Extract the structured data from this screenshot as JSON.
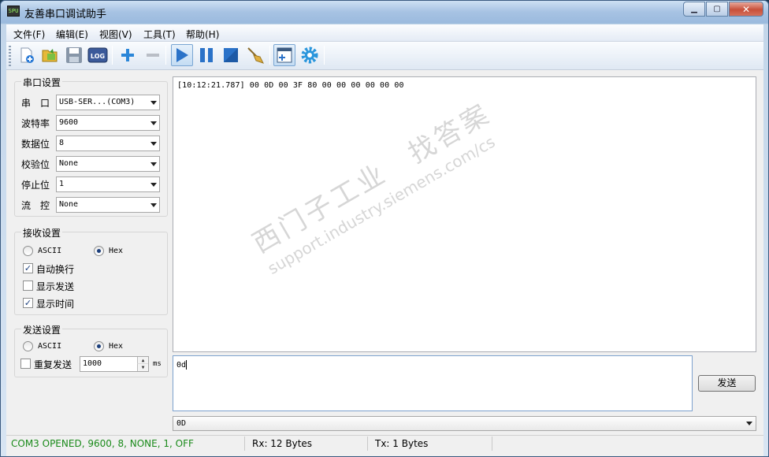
{
  "window": {
    "title": "友善串口调试助手",
    "icon_text": "SPU"
  },
  "menu": [
    {
      "label": "文件(F)"
    },
    {
      "label": "编辑(E)"
    },
    {
      "label": "视图(V)"
    },
    {
      "label": "工具(T)"
    },
    {
      "label": "帮助(H)"
    }
  ],
  "toolbar": {
    "log_label": "LOG",
    "icons": [
      "new-file-icon",
      "open-folder-icon",
      "save-icon",
      "log-icon",
      "add-icon",
      "remove-icon",
      "play-icon",
      "pause-icon",
      "stop-icon",
      "clear-broom-icon",
      "add-window-icon",
      "settings-gear-icon"
    ]
  },
  "serial_settings": {
    "title": "串口设置",
    "rows": [
      {
        "label": "串　口",
        "value": "USB-SER...(COM3)"
      },
      {
        "label": "波特率",
        "value": "9600"
      },
      {
        "label": "数据位",
        "value": "8"
      },
      {
        "label": "校验位",
        "value": "None"
      },
      {
        "label": "停止位",
        "value": "1"
      },
      {
        "label": "流　控",
        "value": "None"
      }
    ]
  },
  "receive_settings": {
    "title": "接收设置",
    "ascii_label": "ASCII",
    "hex_label": "Hex",
    "mode": "Hex",
    "auto_newline_label": "自动换行",
    "auto_newline": true,
    "show_send_label": "显示发送",
    "show_send": false,
    "show_time_label": "显示时间",
    "show_time": true
  },
  "send_settings": {
    "title": "发送设置",
    "ascii_label": "ASCII",
    "hex_label": "Hex",
    "mode": "Hex",
    "repeat_label": "重复发送",
    "repeat": false,
    "interval": "1000",
    "interval_unit": "ms"
  },
  "receive_area": {
    "line": "[10:12:21.787] 00 0D 00 3F 80 00 00 00 00 00 00",
    "watermark_cn": "西门子工业　找答案",
    "watermark_url": "support.industry.siemens.com/cs"
  },
  "send_area": {
    "text": "0d",
    "send_button": "发送"
  },
  "history": {
    "value": "0D"
  },
  "status": {
    "port": "COM3 OPENED, 9600, 8, NONE, 1, OFF",
    "rx": "Rx: 12 Bytes",
    "tx": "Tx: 1 Bytes",
    "port_color": "#1a8a1a"
  }
}
